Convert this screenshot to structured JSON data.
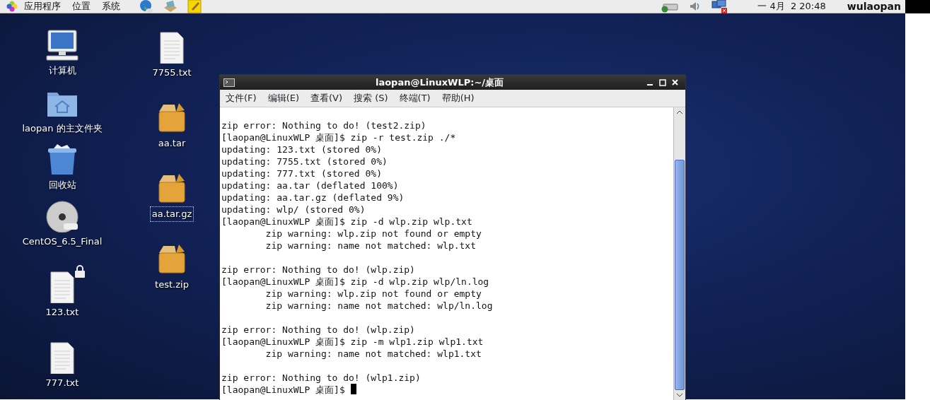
{
  "top_panel": {
    "menus": [
      "应用程序",
      "位置",
      "系统"
    ],
    "clock": "一 4月  2 20:48",
    "user": "wulaopan"
  },
  "desktop_icons": [
    {
      "label": "计算机",
      "kind": "computer",
      "selected": false
    },
    {
      "label": "laopan 的主文件夹",
      "kind": "home",
      "selected": false
    },
    {
      "label": "回收站",
      "kind": "trash",
      "selected": false
    },
    {
      "label": "CentOS_6.5_Final",
      "kind": "dvd",
      "selected": false
    },
    {
      "label": "123.txt",
      "kind": "text",
      "selected": false,
      "locked": true
    },
    {
      "label": "777.txt",
      "kind": "text",
      "selected": false
    },
    {
      "label": "7755.txt",
      "kind": "text",
      "selected": false
    },
    {
      "label": "aa.tar",
      "kind": "archive",
      "selected": false
    },
    {
      "label": "aa.tar.gz",
      "kind": "archive",
      "selected": true
    },
    {
      "label": "test.zip",
      "kind": "archive",
      "selected": false
    }
  ],
  "terminal": {
    "title": "laopan@LinuxWLP:~/桌面",
    "menu": [
      "文件(F)",
      "编辑(E)",
      "查看(V)",
      "搜索 (S)",
      "终端(T)",
      "帮助(H)"
    ],
    "lines": [
      {
        "kind": "blank"
      },
      {
        "kind": "output",
        "text": "zip error: Nothing to do! (test2.zip)"
      },
      {
        "kind": "prompt",
        "text": "[laopan@LinuxWLP 桌面]$ zip -r test.zip ./*"
      },
      {
        "kind": "output",
        "text": "updating: 123.txt (stored 0%)"
      },
      {
        "kind": "output",
        "text": "updating: 7755.txt (stored 0%)"
      },
      {
        "kind": "output",
        "text": "updating: 777.txt (stored 0%)"
      },
      {
        "kind": "output",
        "text": "updating: aa.tar (deflated 100%)"
      },
      {
        "kind": "output",
        "text": "updating: aa.tar.gz (deflated 9%)"
      },
      {
        "kind": "output",
        "text": "updating: wlp/ (stored 0%)"
      },
      {
        "kind": "prompt",
        "text": "[laopan@LinuxWLP 桌面]$ zip -d wlp.zip wlp.txt"
      },
      {
        "kind": "output",
        "text": "        zip warning: wlp.zip not found or empty"
      },
      {
        "kind": "output",
        "text": "        zip warning: name not matched: wlp.txt"
      },
      {
        "kind": "blank"
      },
      {
        "kind": "output",
        "text": "zip error: Nothing to do! (wlp.zip)"
      },
      {
        "kind": "prompt",
        "text": "[laopan@LinuxWLP 桌面]$ zip -d wlp.zip wlp/ln.log"
      },
      {
        "kind": "output",
        "text": "        zip warning: wlp.zip not found or empty"
      },
      {
        "kind": "output",
        "text": "        zip warning: name not matched: wlp/ln.log"
      },
      {
        "kind": "blank"
      },
      {
        "kind": "output",
        "text": "zip error: Nothing to do! (wlp.zip)"
      },
      {
        "kind": "prompt",
        "text": "[laopan@LinuxWLP 桌面]$ zip -m wlp1.zip wlp1.txt"
      },
      {
        "kind": "output",
        "text": "        zip warning: name not matched: wlp1.txt"
      },
      {
        "kind": "blank"
      },
      {
        "kind": "output",
        "text": "zip error: Nothing to do! (wlp1.zip)"
      },
      {
        "kind": "prompt",
        "text": "[laopan@LinuxWLP 桌面]$",
        "cursor": true
      }
    ]
  }
}
